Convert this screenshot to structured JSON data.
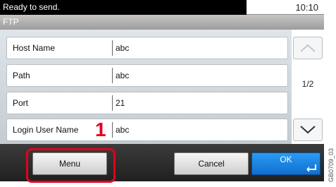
{
  "status": {
    "message": "Ready to send.",
    "time": "10:10"
  },
  "screen": {
    "title": "FTP"
  },
  "fields": [
    {
      "label": "Host Name",
      "value": "abc"
    },
    {
      "label": "Path",
      "value": "abc"
    },
    {
      "label": "Port",
      "value": "21"
    },
    {
      "label": "Login User Name",
      "value": "abc"
    }
  ],
  "pagination": {
    "indicator": "1/2"
  },
  "buttons": {
    "menu": "Menu",
    "cancel": "Cancel",
    "ok": "OK"
  },
  "annotation": {
    "callout_number": "1",
    "image_code": "GB0709_03"
  },
  "colors": {
    "highlight": "#e3001b",
    "ok_button": "#1580e0",
    "status_bar": "#000000"
  },
  "icons": {
    "scroll_up": "chevron-up-icon",
    "scroll_down": "chevron-down-icon",
    "ok_enter": "enter-return-icon"
  }
}
